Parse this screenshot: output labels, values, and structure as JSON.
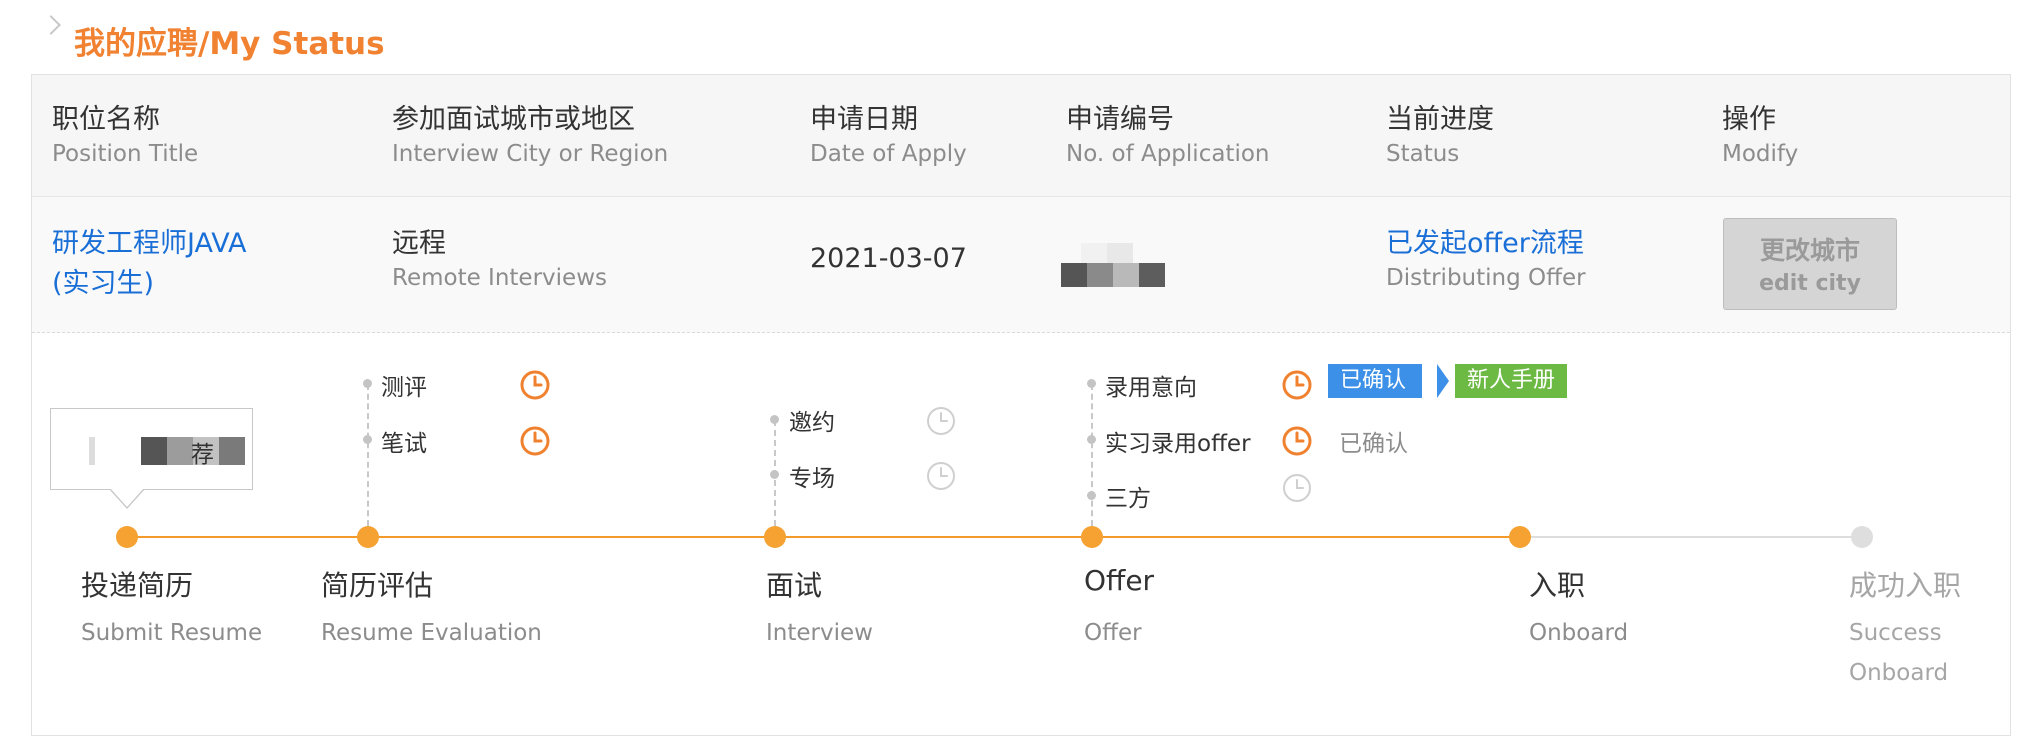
{
  "page_title": "我的应聘/My Status",
  "table": {
    "headers": [
      {
        "cn": "职位名称",
        "en": "Position Title"
      },
      {
        "cn": "参加面试城市或地区",
        "en": "Interview City or Region"
      },
      {
        "cn": "申请日期",
        "en": "Date of Apply"
      },
      {
        "cn": "申请编号",
        "en": "No. of Application"
      },
      {
        "cn": "当前进度",
        "en": "Status"
      },
      {
        "cn": "操作",
        "en": "Modify"
      }
    ],
    "row": {
      "position_line1": "研发工程师JAVA",
      "position_line2": "(实习生)",
      "city_cn": "远程",
      "city_en": "Remote Interviews",
      "date": "2021-03-07",
      "status_cn": "已发起offer流程",
      "status_en": "Distributing Offer",
      "edit_cn": "更改城市",
      "edit_en": "edit city"
    }
  },
  "tooltip_text": "荐",
  "progress": {
    "stages": [
      {
        "cn": "投递简历",
        "en": "Submit Resume"
      },
      {
        "cn": "简历评估",
        "en": "Resume Evaluation"
      },
      {
        "cn": "面试",
        "en": "Interview"
      },
      {
        "cn": "Offer",
        "en": "Offer"
      },
      {
        "cn": "入职",
        "en": "Onboard"
      },
      {
        "cn": "成功入职",
        "en_line1": "Success",
        "en_line2": "Onboard"
      }
    ],
    "substeps": {
      "eval": [
        "测评",
        "笔试"
      ],
      "interview": [
        "邀约",
        "专场"
      ],
      "offer": [
        "录用意向",
        "实习录用offer",
        "三方"
      ]
    },
    "tag_confirmed": "已确认",
    "tag_handbook": "新人手册",
    "offer_confirmed": "已确认"
  },
  "colors": {
    "accent": "#f08232",
    "node": "#f5a233",
    "link": "#1a6fd7",
    "tag_blue": "#3c90e8",
    "tag_green": "#6cb944"
  },
  "icons": {
    "active_clock": "clock-icon-orange",
    "inactive_clock": "clock-icon-gray"
  }
}
